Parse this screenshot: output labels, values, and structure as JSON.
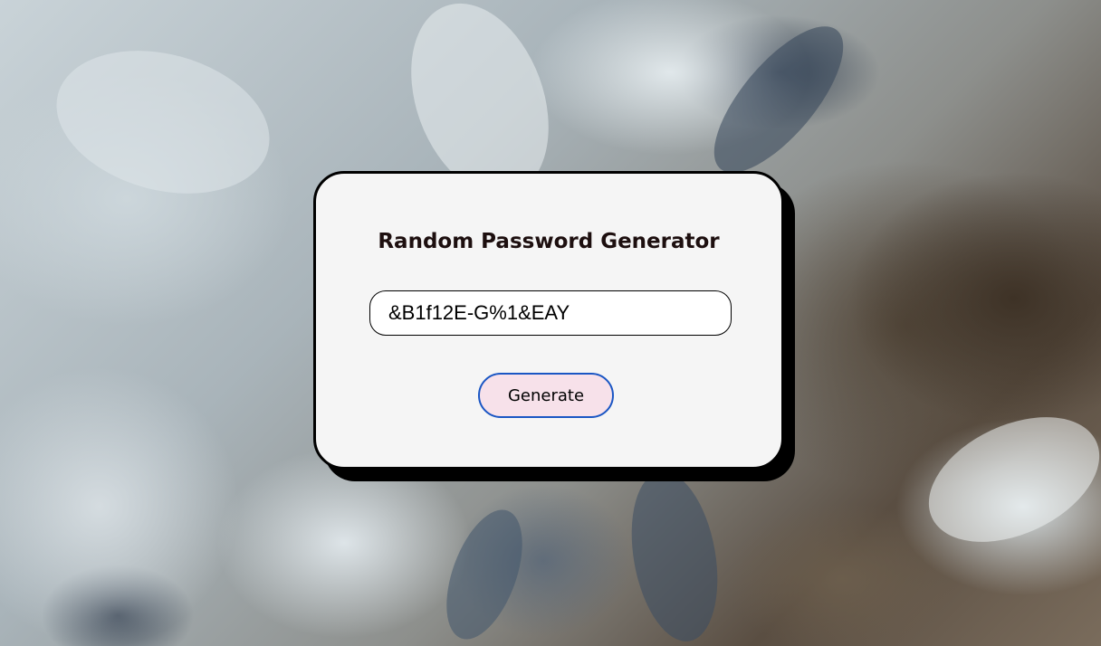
{
  "page": {
    "background_description_icon": "snowy-mountain-satellite-background"
  },
  "card": {
    "title": "Random Password Generator",
    "password_value": "&B1f12E-G%1&EAY",
    "generate_label": "Generate"
  },
  "colors": {
    "card_background": "#f5f5f5",
    "card_border": "#000000",
    "button_background": "#f7e1ea",
    "button_border": "#1a56c4",
    "title_color": "#1d0f0f"
  }
}
